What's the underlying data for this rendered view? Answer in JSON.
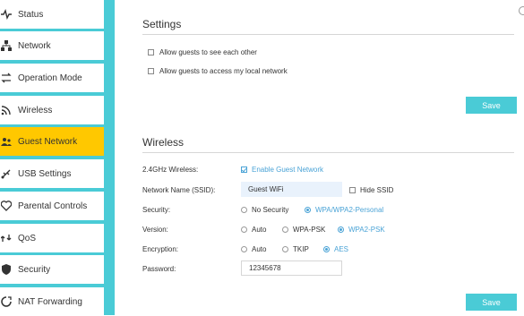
{
  "sidebar": {
    "items": [
      {
        "label": "Status",
        "icon": "pulse-icon",
        "active": false
      },
      {
        "label": "Network",
        "icon": "network-icon",
        "active": false
      },
      {
        "label": "Operation Mode",
        "icon": "operation-mode-icon",
        "active": false
      },
      {
        "label": "Wireless",
        "icon": "wifi-icon",
        "active": false
      },
      {
        "label": "Guest Network",
        "icon": "guest-network-icon",
        "active": true
      },
      {
        "label": "USB Settings",
        "icon": "usb-icon",
        "active": false
      },
      {
        "label": "Parental Controls",
        "icon": "parental-controls-icon",
        "active": false
      },
      {
        "label": "QoS",
        "icon": "qos-icon",
        "active": false
      },
      {
        "label": "Security",
        "icon": "shield-icon",
        "active": false
      },
      {
        "label": "NAT Forwarding",
        "icon": "nat-forwarding-icon",
        "active": false
      }
    ]
  },
  "settings": {
    "title": "Settings",
    "options": [
      {
        "label": "Allow guests to see each other",
        "checked": false
      },
      {
        "label": "Allow guests to access my local network",
        "checked": false
      }
    ],
    "save_label": "Save"
  },
  "wireless": {
    "title": "Wireless",
    "band_label": "2.4GHz Wireless:",
    "enable_label": "Enable Guest Network",
    "enable_checked": true,
    "ssid_label": "Network Name (SSID):",
    "ssid_value": "Guest WiFi",
    "hide_ssid_label": "Hide SSID",
    "hide_ssid_checked": false,
    "security_label": "Security:",
    "security_options": [
      "No Security",
      "WPA/WPA2-Personal"
    ],
    "security_selected": "WPA/WPA2-Personal",
    "version_label": "Version:",
    "version_options": [
      "Auto",
      "WPA-PSK",
      "WPA2-PSK"
    ],
    "version_selected": "WPA2-PSK",
    "encryption_label": "Encryption:",
    "encryption_options": [
      "Auto",
      "TKIP",
      "AES"
    ],
    "encryption_selected": "AES",
    "password_label": "Password:",
    "password_value": "12345678",
    "save_label": "Save"
  },
  "colors": {
    "accent": "#4acbd6",
    "active_nav": "#ffc800",
    "link_blue": "#4aa3d6"
  }
}
